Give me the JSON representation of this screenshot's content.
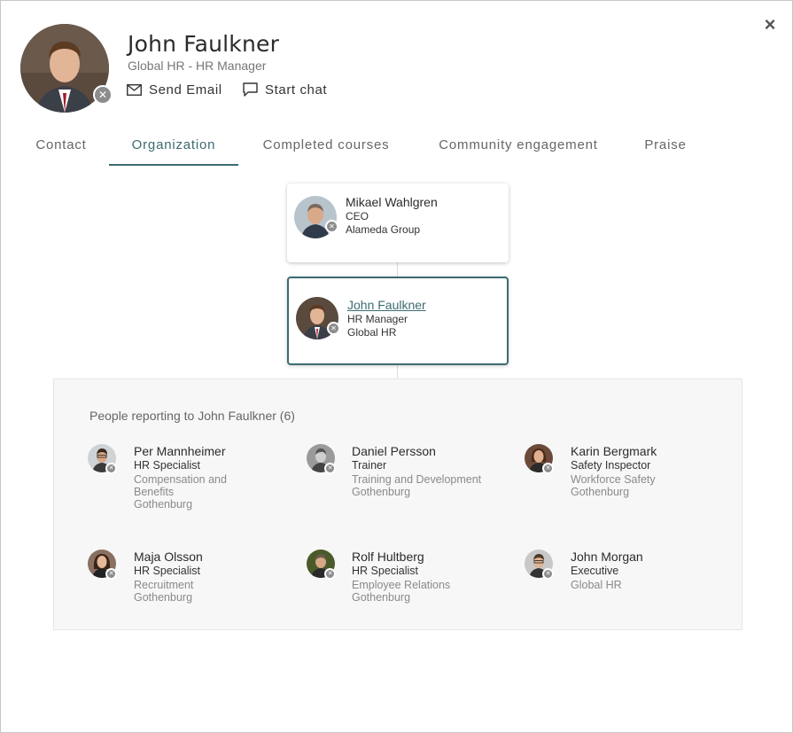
{
  "header": {
    "name": "John Faulkner",
    "subtitle": "Global HR - HR Manager",
    "send_email": "Send Email",
    "start_chat": "Start chat",
    "close": "×"
  },
  "tabs": [
    {
      "label": "Contact"
    },
    {
      "label": "Organization"
    },
    {
      "label": "Completed courses"
    },
    {
      "label": "Community engagement"
    },
    {
      "label": "Praise"
    }
  ],
  "active_tab": "Organization",
  "org": {
    "manager": {
      "name": "Mikael Wahlgren",
      "title": "CEO",
      "unit": "Alameda Group"
    },
    "self": {
      "name": "John Faulkner",
      "title": "HR Manager",
      "unit": "Global HR"
    }
  },
  "reports": {
    "title": "People reporting to John Faulkner (6)",
    "people": [
      {
        "name": "Per Mannheimer",
        "title": "HR Specialist",
        "meta": "Compensation and Benefits\nGothenburg"
      },
      {
        "name": "Daniel Persson",
        "title": "Trainer",
        "meta": "Training and Development\nGothenburg"
      },
      {
        "name": "Karin Bergmark",
        "title": "Safety Inspector",
        "meta": "Workforce Safety\nGothenburg"
      },
      {
        "name": "Maja Olsson",
        "title": "HR Specialist",
        "meta": "Recruitment\nGothenburg"
      },
      {
        "name": "Rolf Hultberg",
        "title": "HR Specialist",
        "meta": "Employee Relations\nGothenburg"
      },
      {
        "name": "John Morgan",
        "title": "Executive",
        "meta": "Global HR"
      }
    ]
  },
  "colors": {
    "accent": "#3d6b70",
    "status_badge": "#8c8c8c",
    "panel_bg": "#f7f7f7"
  },
  "icons": {
    "close": "close-icon",
    "email": "envelope-icon",
    "chat": "chat-bubble-icon",
    "status": "status-offline-icon"
  }
}
